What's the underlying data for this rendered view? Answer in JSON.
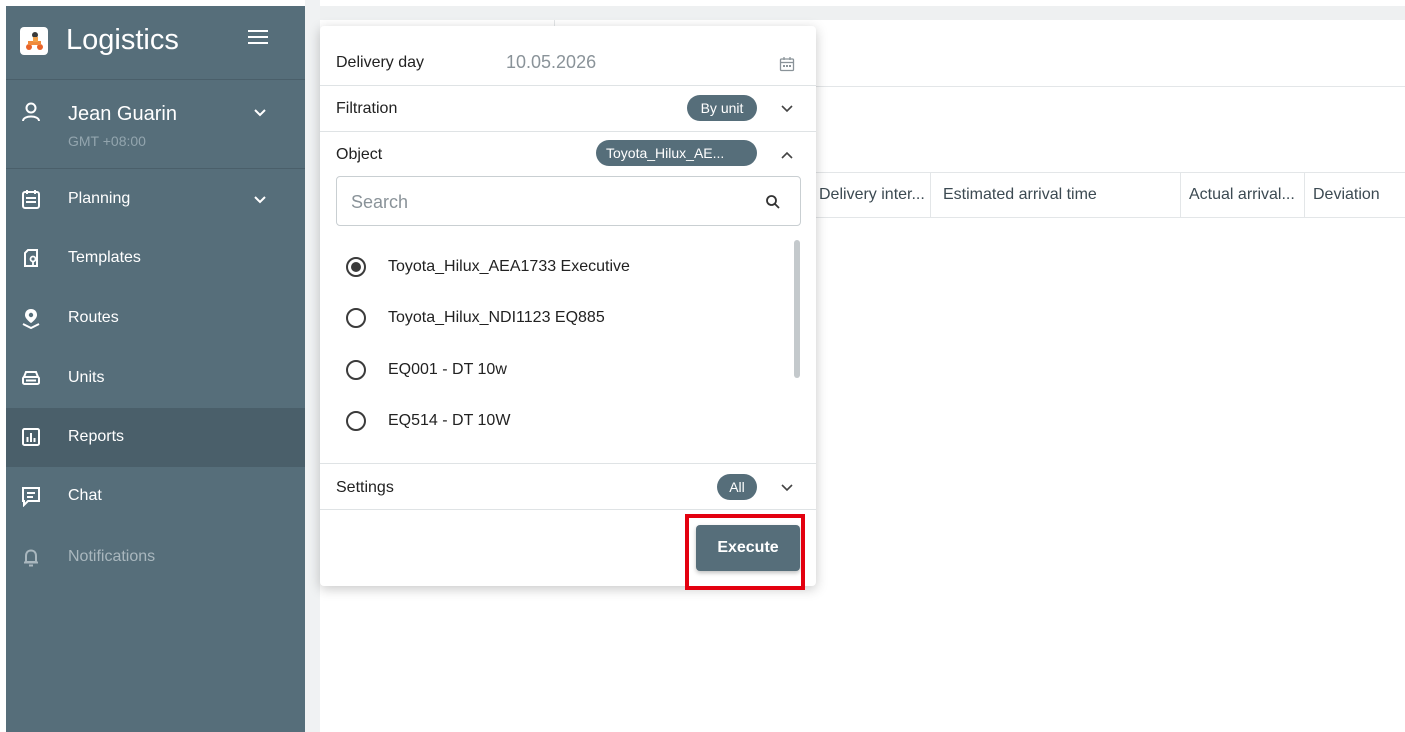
{
  "app": {
    "title": "Logistics"
  },
  "user": {
    "name": "Jean Guarin",
    "timezone": "GMT +08:00"
  },
  "nav": [
    {
      "label": "Planning",
      "icon": "calendar-icon",
      "expandable": true
    },
    {
      "label": "Templates",
      "icon": "template-icon"
    },
    {
      "label": "Routes",
      "icon": "route-pin-icon"
    },
    {
      "label": "Units",
      "icon": "car-icon"
    },
    {
      "label": "Reports",
      "icon": "bar-chart-icon",
      "active": true
    },
    {
      "label": "Chat",
      "icon": "chat-icon"
    },
    {
      "label": "Notifications",
      "icon": "bell-icon",
      "muted": true
    }
  ],
  "table": {
    "columns": [
      "Delivery inter...",
      "Estimated arrival time",
      "Actual arrival...",
      "Deviation"
    ]
  },
  "popup": {
    "delivery_day": {
      "label": "Delivery day",
      "value": "10.05.2026"
    },
    "filtration": {
      "label": "Filtration",
      "chip": "By unit"
    },
    "object": {
      "label": "Object",
      "chip": "Toyota_Hilux_AE...",
      "search_placeholder": "Search",
      "options": [
        {
          "label": "Toyota_Hilux_AEA1733 Executive",
          "selected": true
        },
        {
          "label": "Toyota_Hilux_NDI1123 EQ885",
          "selected": false
        },
        {
          "label": "EQ001 - DT 10w",
          "selected": false
        },
        {
          "label": "EQ514 - DT 10W",
          "selected": false
        }
      ]
    },
    "settings": {
      "label": "Settings",
      "chip": "All"
    },
    "execute_label": "Execute"
  },
  "colors": {
    "sidebar": "#566e7a",
    "chip": "#566e7a",
    "highlight": "#e3000f"
  }
}
